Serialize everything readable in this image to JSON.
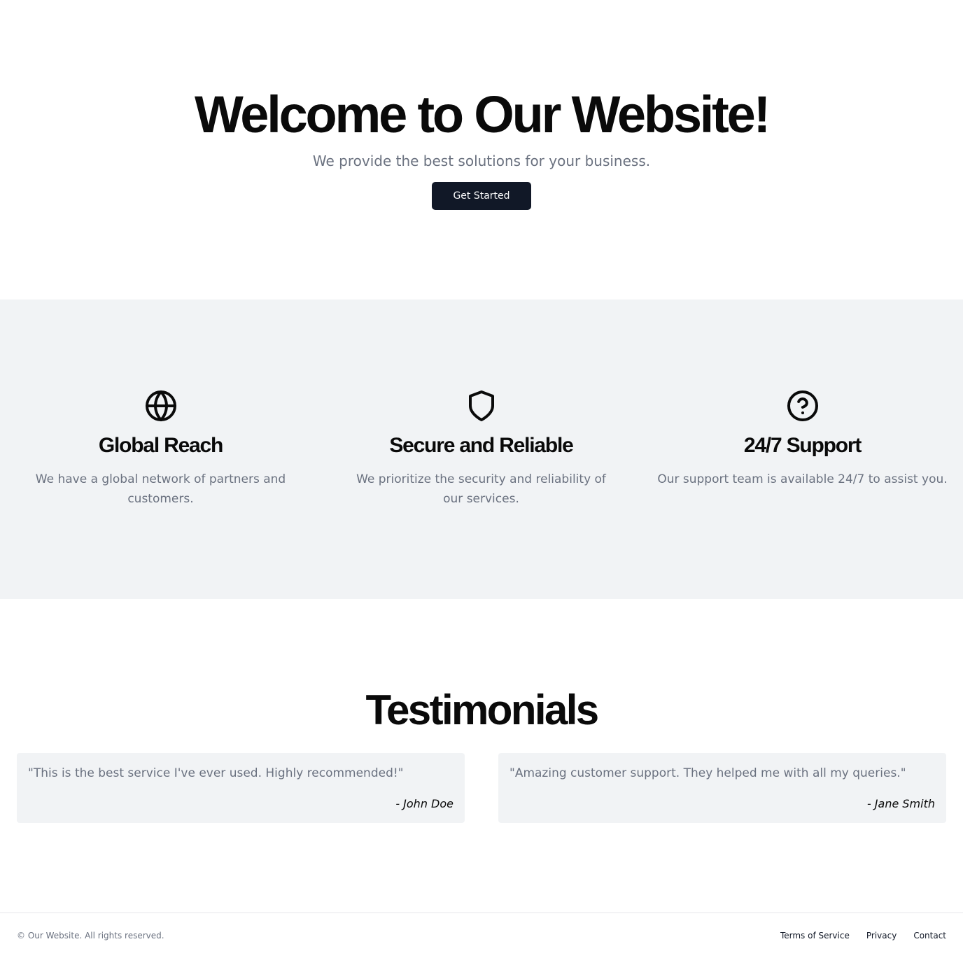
{
  "hero": {
    "title": "Welcome to Our Website!",
    "subtitle": "We provide the best solutions for your business.",
    "cta_label": "Get Started"
  },
  "features": [
    {
      "icon": "globe-icon",
      "title": "Global Reach",
      "description": "We have a global network of partners and customers."
    },
    {
      "icon": "shield-icon",
      "title": "Secure and Reliable",
      "description": "We prioritize the security and reliability of our services."
    },
    {
      "icon": "help-circle-icon",
      "title": "24/7 Support",
      "description": "Our support team is available 24/7 to assist you."
    }
  ],
  "testimonials": {
    "title": "Testimonials",
    "items": [
      {
        "quote": "\"This is the best service I've ever used. Highly recommended!\"",
        "author": "- John Doe"
      },
      {
        "quote": "\"Amazing customer support. They helped me with all my queries.\"",
        "author": "- Jane Smith"
      }
    ]
  },
  "footer": {
    "copyright": "© Our Website. All rights reserved.",
    "links": [
      "Terms of Service",
      "Privacy",
      "Contact"
    ]
  },
  "colors": {
    "primary_button": "#111827",
    "section_background": "#f1f3f5",
    "muted_text": "#6b7280",
    "heading_text": "#0a0a0a"
  }
}
